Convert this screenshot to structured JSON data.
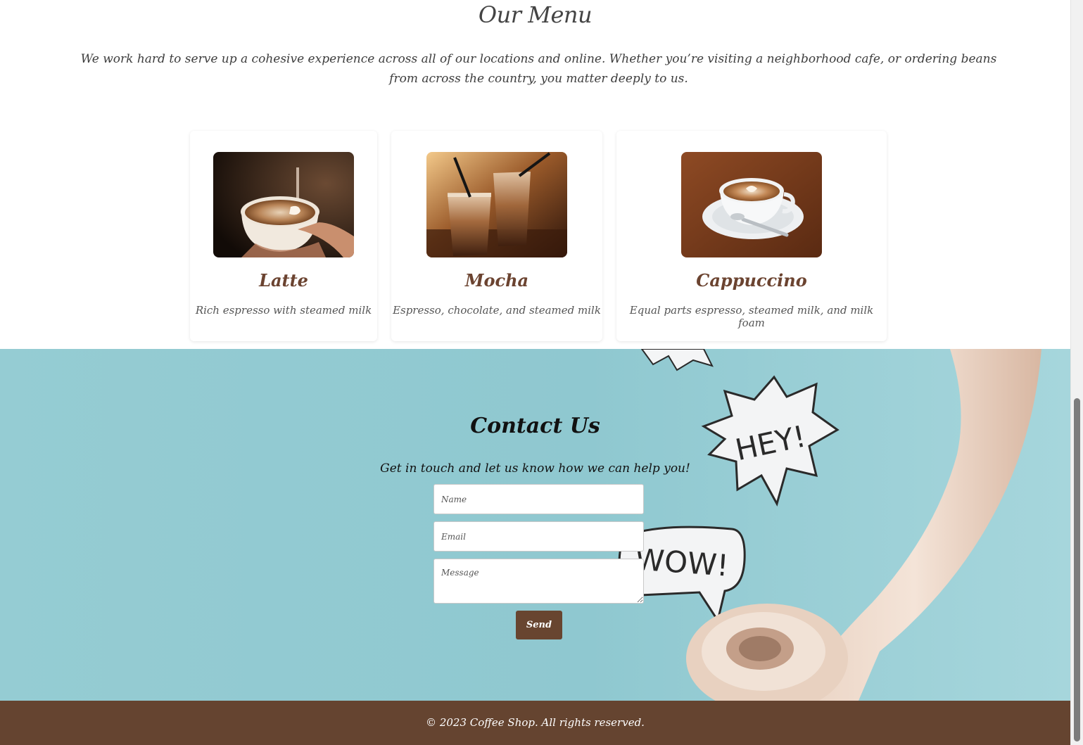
{
  "menu": {
    "title": "Our Menu",
    "intro": "We work hard to serve up a cohesive experience across all of our locations and online. Whether you’re visiting a neighborhood cafe, or ordering beans from across the country, you matter deeply to us.",
    "items": [
      {
        "name": "Latte",
        "description": "Rich espresso with steamed milk",
        "image": "latte-photo"
      },
      {
        "name": "Mocha",
        "description": "Espresso, chocolate, and steamed milk",
        "image": "mocha-photo"
      },
      {
        "name": "Cappuccino",
        "description": "Equal parts espresso, steamed milk, and milk foam",
        "image": "cappuccino-photo"
      }
    ]
  },
  "contact": {
    "title": "Contact Us",
    "subtitle": "Get in touch and let us know how we can help you!",
    "name_placeholder": "Name",
    "email_placeholder": "Email",
    "message_placeholder": "Message",
    "send_label": "Send",
    "background_art": {
      "bubble_1": "HEY!",
      "bubble_2": "WOW!"
    }
  },
  "footer": {
    "text": "© 2023 Coffee Shop. All rights reserved."
  },
  "colors": {
    "brand_brown": "#684530",
    "footer_brown": "#654430",
    "contact_bg": "#8fc8d0",
    "item_title": "#6b4330"
  }
}
